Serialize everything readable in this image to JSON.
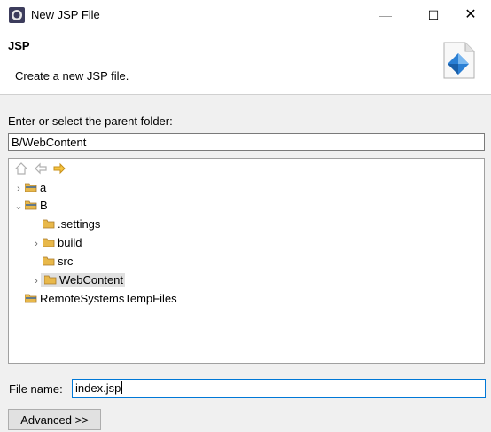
{
  "window": {
    "title": "New JSP File",
    "min_label": "—",
    "max_label": "☐",
    "close_label": "✕"
  },
  "header": {
    "title": "JSP",
    "description": "Create a new JSP file."
  },
  "folder": {
    "label": "Enter or select the parent folder:",
    "value": "B/WebContent"
  },
  "tree": {
    "items": [
      {
        "label": "a",
        "twisty": "›",
        "kind": "project"
      },
      {
        "label": "B",
        "twisty": "⌄",
        "kind": "project"
      },
      {
        "label": ".settings",
        "twisty": "",
        "kind": "folder"
      },
      {
        "label": "build",
        "twisty": "›",
        "kind": "folder"
      },
      {
        "label": "src",
        "twisty": "",
        "kind": "folder"
      },
      {
        "label": "WebContent",
        "twisty": "›",
        "kind": "folder",
        "selected": true
      },
      {
        "label": "RemoteSystemsTempFiles",
        "twisty": "",
        "kind": "project-folder"
      }
    ]
  },
  "filename": {
    "label": "File name:",
    "value": "index.jsp"
  },
  "buttons": {
    "advanced": "Advanced >>"
  },
  "colors": {
    "folder": "#e8b84a",
    "accent": "#0078d7",
    "arrow": "#e8a317"
  }
}
